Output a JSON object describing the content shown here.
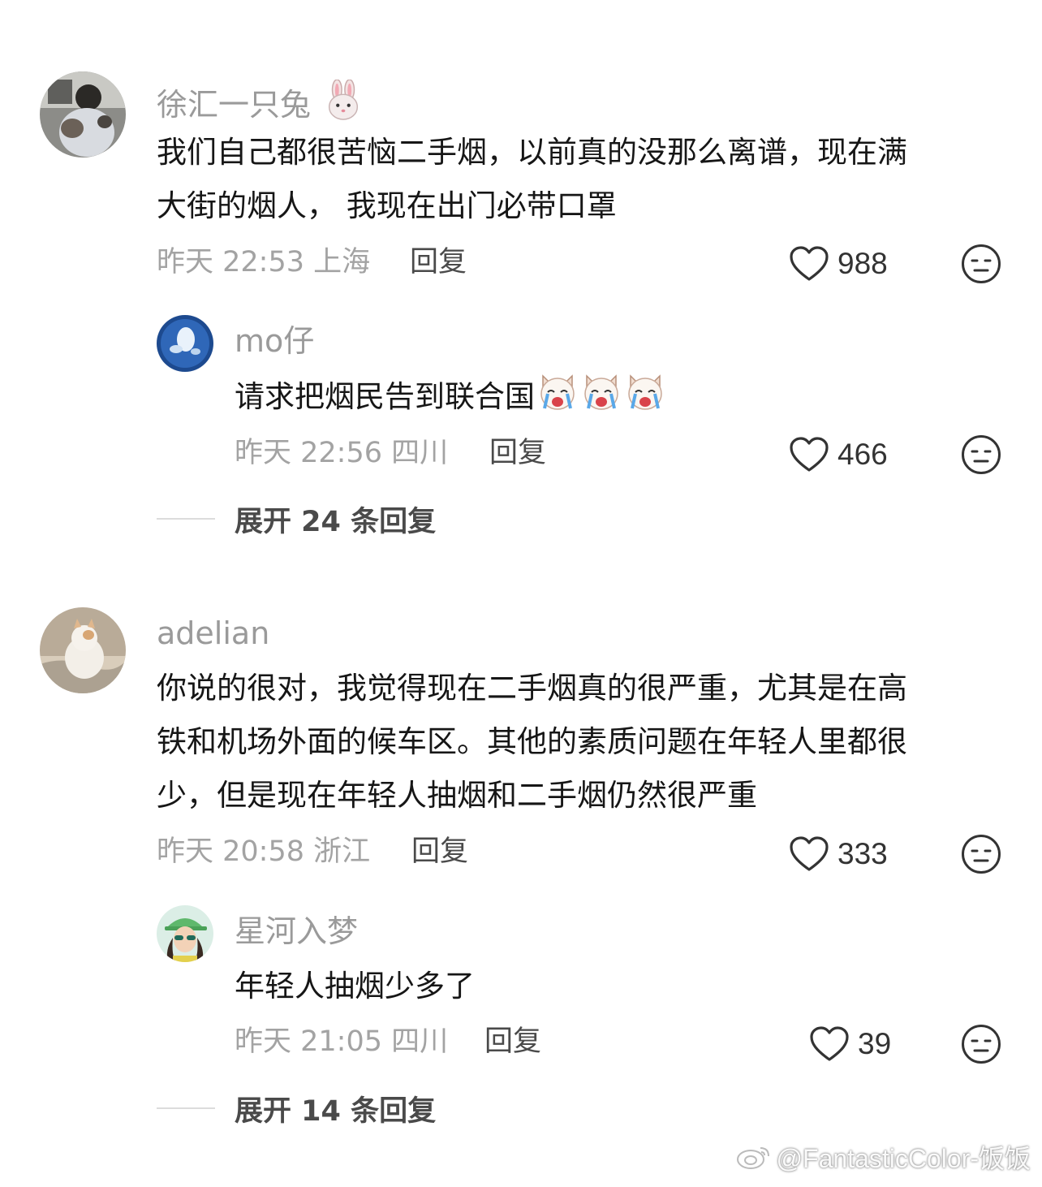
{
  "comments": [
    {
      "user": "徐汇一只兔",
      "user_emoji": "rabbit-face",
      "text_lines": [
        "我们自己都很苦恼二手烟，以前真的没那么离谱，现在满",
        "大街的烟人， 我现在出门必带口罩"
      ],
      "meta": "昨天 22:53 上海",
      "reply_label": "回复",
      "likes": "988",
      "replies": [
        {
          "user": "mo仔",
          "text": "请求把烟民告到联合国",
          "text_emojis": [
            "crying-dog",
            "crying-dog",
            "crying-dog"
          ],
          "meta": "昨天 22:56 四川",
          "reply_label": "回复",
          "likes": "466"
        }
      ],
      "expand_label": "展开 24 条回复"
    },
    {
      "user": "adelian",
      "text_lines": [
        "你说的很对，我觉得现在二手烟真的很严重，尤其是在高",
        "铁和机场外面的候车区。其他的素质问题在年轻人里都很",
        "少，但是现在年轻人抽烟和二手烟仍然很严重"
      ],
      "meta": "昨天 20:58 浙江",
      "reply_label": "回复",
      "likes": "333",
      "replies": [
        {
          "user": "星河入梦",
          "text": "年轻人抽烟少多了",
          "meta": "昨天 21:05 四川",
          "reply_label": "回复",
          "likes": "39"
        }
      ],
      "expand_label": "展开 14 条回复"
    }
  ],
  "watermark": "@FantasticColor-饭饭",
  "colors": {
    "username": "#9a9a9a",
    "meta": "#a3a3a3",
    "text": "#161616"
  }
}
